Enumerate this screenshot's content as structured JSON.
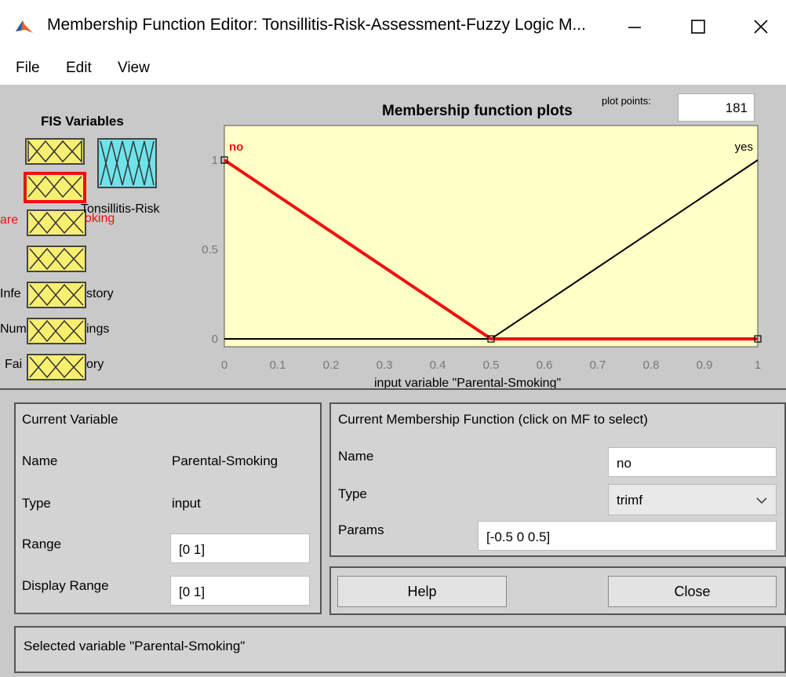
{
  "window": {
    "title": "Membership Function Editor: Tonsillitis-Risk-Assessment-Fuzzy Logic M...",
    "minimize_icon": "minimize-icon",
    "maximize_icon": "maximize-icon",
    "close_icon": "close-icon"
  },
  "menu": [
    "File",
    "Edit",
    "View"
  ],
  "fis": {
    "title": "FIS Variables",
    "inputs": [
      {
        "label": ""
      },
      {
        "label": "Parental-Smoking",
        "shown": "are",
        "shown_right": "oking",
        "selected": true
      },
      {
        "label": ""
      },
      {
        "label": "Infe…story",
        "shown": "Infe",
        "shown_right": "story"
      },
      {
        "label": "Num…ings",
        "shown": "Num",
        "shown_right": "ings"
      },
      {
        "label": "Fa…ory",
        "shown": "Fai",
        "shown_right": "ory"
      }
    ],
    "output": {
      "label": "Tonsillitis-Risk"
    }
  },
  "plot": {
    "title": "Membership function plots",
    "plot_points_label": "plot points:",
    "plot_points": "181",
    "xlabel": "input variable \"Parental-Smoking\"",
    "xticks": [
      "0",
      "0.1",
      "0.2",
      "0.3",
      "0.4",
      "0.5",
      "0.6",
      "0.7",
      "0.8",
      "0.9",
      "1"
    ],
    "yticks": [
      "0",
      "0.5",
      "1"
    ],
    "mf_labels": {
      "left": "no",
      "right": "yes"
    },
    "colors": {
      "background": "#ffffc8",
      "selected_mf": "#e11",
      "other_mf": "#000"
    }
  },
  "chart_data": {
    "type": "line",
    "xlim": [
      0,
      1
    ],
    "ylim": [
      0,
      1
    ],
    "series": [
      {
        "name": "no",
        "x": [
          0,
          0.5,
          1
        ],
        "y": [
          1,
          0,
          0
        ],
        "selected": true
      },
      {
        "name": "yes",
        "x": [
          0,
          0.5,
          1
        ],
        "y": [
          0,
          0,
          1
        ]
      }
    ]
  },
  "current_variable": {
    "title": "Current Variable",
    "name_label": "Name",
    "name_value": "Parental-Smoking",
    "type_label": "Type",
    "type_value": "input",
    "range_label": "Range",
    "range_value": "[0 1]",
    "display_range_label": "Display Range",
    "display_range_value": "[0 1]"
  },
  "current_mf": {
    "title": "Current Membership Function (click on MF to select)",
    "name_label": "Name",
    "name_value": "no",
    "type_label": "Type",
    "type_value": "trimf",
    "params_label": "Params",
    "params_value": "[-0.5 0 0.5]"
  },
  "buttons": {
    "help": "Help",
    "close": "Close"
  },
  "status": "Selected variable \"Parental-Smoking\""
}
